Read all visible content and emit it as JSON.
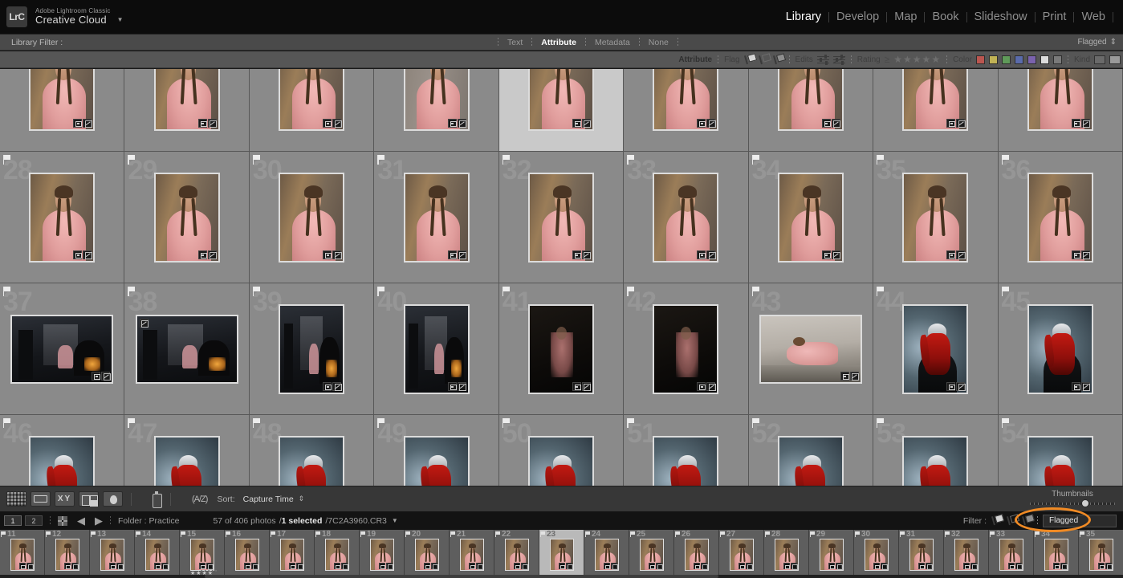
{
  "app": {
    "logo_text": "LrC",
    "product_line1": "Adobe Lightroom Classic",
    "product_line2": "Creative Cloud",
    "identity_caret": "▼"
  },
  "modules": [
    {
      "label": "Library",
      "active": true
    },
    {
      "label": "Develop",
      "active": false
    },
    {
      "label": "Map",
      "active": false
    },
    {
      "label": "Book",
      "active": false
    },
    {
      "label": "Slideshow",
      "active": false
    },
    {
      "label": "Print",
      "active": false
    },
    {
      "label": "Web",
      "active": false
    }
  ],
  "library_filter": {
    "label": "Library Filter :",
    "tabs": [
      {
        "label": "Text",
        "active": false
      },
      {
        "label": "Attribute",
        "active": true
      },
      {
        "label": "Metadata",
        "active": false
      },
      {
        "label": "None",
        "active": false
      }
    ],
    "saved_preset": "Flagged",
    "saved_preset_caret": "⇕"
  },
  "attribute_bar": {
    "attribute_label": "Attribute",
    "flag_label": "Flag",
    "flag_icons": [
      "flag-picked-icon",
      "flag-unflagged-icon",
      "flag-rejected-icon"
    ],
    "edits_label": "Edits",
    "edit_icons": [
      "edited-icon",
      "unedited-icon"
    ],
    "rating_label": "Rating",
    "rating_operator": "≥",
    "stars": "★★★★★",
    "star_count": 5,
    "rating_value": 0,
    "color_label": "Color",
    "color_swatches": [
      "#b9544f",
      "#c0b councils"
    ],
    "colors": [
      "#bb5650",
      "#c0b255",
      "#5f9a59",
      "#5a6bab",
      "#7a62ad",
      "#dcdcdc",
      "#7a7a7a"
    ],
    "kind_label": "Kind",
    "kind_icons": [
      "photo-kind-icon",
      "video-kind-icon"
    ]
  },
  "grid": {
    "rows": [
      {
        "clipped_top": true,
        "cells": [
          {
            "num": "",
            "flag": true,
            "selected": false,
            "orient": "portrait",
            "badges": [
              "crop",
              "edit"
            ],
            "art": "pink-studio"
          },
          {
            "num": "",
            "flag": true,
            "selected": false,
            "orient": "portrait",
            "badges": [
              "crop",
              "edit"
            ],
            "art": "pink-studio"
          },
          {
            "num": "",
            "flag": true,
            "selected": false,
            "orient": "portrait",
            "badges": [
              "crop",
              "edit"
            ],
            "art": "pink-studio"
          },
          {
            "num": "",
            "flag": true,
            "selected": false,
            "orient": "portrait",
            "badges": [
              "crop",
              "edit"
            ],
            "art": "pink-gray"
          },
          {
            "num": "",
            "flag": true,
            "selected": true,
            "orient": "portrait",
            "badges": [
              "crop",
              "edit"
            ],
            "art": "pink-studio"
          },
          {
            "num": "",
            "flag": true,
            "selected": false,
            "orient": "portrait",
            "badges": [
              "crop",
              "edit"
            ],
            "art": "pink-studio"
          },
          {
            "num": "",
            "flag": true,
            "selected": false,
            "orient": "portrait",
            "badges": [
              "crop",
              "edit"
            ],
            "art": "pink-studio"
          },
          {
            "num": "",
            "flag": true,
            "selected": false,
            "orient": "portrait",
            "badges": [
              "crop",
              "edit"
            ],
            "art": "pink-studio"
          },
          {
            "num": "",
            "flag": true,
            "selected": false,
            "orient": "portrait",
            "badges": [
              "crop",
              "edit"
            ],
            "art": "pink-studio"
          }
        ]
      },
      {
        "clipped_top": false,
        "cells": [
          {
            "num": "28",
            "flag": true,
            "selected": false,
            "orient": "portrait",
            "badges": [
              "crop",
              "edit"
            ],
            "art": "pink-studio"
          },
          {
            "num": "29",
            "flag": true,
            "selected": false,
            "orient": "portrait",
            "badges": [
              "crop",
              "edit"
            ],
            "art": "pink-studio"
          },
          {
            "num": "30",
            "flag": true,
            "selected": false,
            "orient": "portrait",
            "badges": [
              "crop",
              "edit"
            ],
            "art": "pink-studio"
          },
          {
            "num": "31",
            "flag": true,
            "selected": false,
            "orient": "portrait",
            "badges": [
              "crop",
              "edit"
            ],
            "art": "pink-studio"
          },
          {
            "num": "32",
            "flag": true,
            "selected": false,
            "orient": "portrait",
            "badges": [
              "crop",
              "edit"
            ],
            "art": "pink-studio"
          },
          {
            "num": "33",
            "flag": true,
            "selected": false,
            "orient": "portrait",
            "badges": [
              "crop",
              "edit"
            ],
            "art": "pink-studio"
          },
          {
            "num": "34",
            "flag": true,
            "selected": false,
            "orient": "portrait",
            "badges": [
              "crop",
              "edit"
            ],
            "art": "pink-studio"
          },
          {
            "num": "35",
            "flag": true,
            "selected": false,
            "orient": "portrait",
            "badges": [
              "crop",
              "edit"
            ],
            "art": "pink-studio"
          },
          {
            "num": "36",
            "flag": true,
            "selected": false,
            "orient": "portrait",
            "badges": [
              "crop",
              "edit"
            ],
            "art": "pink-studio"
          }
        ]
      },
      {
        "clipped_top": false,
        "cells": [
          {
            "num": "37",
            "flag": true,
            "selected": false,
            "orient": "landscape",
            "badges": [
              "crop",
              "edit"
            ],
            "art": "dark-venue"
          },
          {
            "num": "38",
            "flag": true,
            "selected": false,
            "orient": "landscape",
            "badges": [
              "edit-tl"
            ],
            "art": "dark-venue"
          },
          {
            "num": "39",
            "flag": true,
            "selected": false,
            "orient": "portrait",
            "badges": [
              "crop",
              "edit"
            ],
            "art": "dark-venue"
          },
          {
            "num": "40",
            "flag": true,
            "selected": false,
            "orient": "portrait",
            "badges": [
              "crop",
              "edit"
            ],
            "art": "dark-venue"
          },
          {
            "num": "41",
            "flag": true,
            "selected": false,
            "orient": "portrait",
            "badges": [
              "crop",
              "edit"
            ],
            "art": "dark-room"
          },
          {
            "num": "42",
            "flag": true,
            "selected": false,
            "orient": "portrait",
            "badges": [
              "crop",
              "edit"
            ],
            "art": "dark-room"
          },
          {
            "num": "43",
            "flag": true,
            "selected": false,
            "orient": "landscape",
            "badges": [
              "crop",
              "edit"
            ],
            "art": "bed-scene"
          },
          {
            "num": "44",
            "flag": true,
            "selected": false,
            "orient": "portrait",
            "badges": [
              "crop",
              "edit"
            ],
            "art": "red-hair"
          },
          {
            "num": "45",
            "flag": true,
            "selected": false,
            "orient": "portrait",
            "badges": [
              "crop",
              "edit"
            ],
            "art": "red-hair"
          }
        ]
      },
      {
        "clipped_top": false,
        "cells": [
          {
            "num": "46",
            "flag": true,
            "selected": false,
            "orient": "portrait",
            "badges": [],
            "art": "red-hair"
          },
          {
            "num": "47",
            "flag": true,
            "selected": false,
            "orient": "portrait",
            "badges": [],
            "art": "red-hair"
          },
          {
            "num": "48",
            "flag": true,
            "selected": false,
            "orient": "portrait",
            "badges": [],
            "art": "red-hair"
          },
          {
            "num": "49",
            "flag": true,
            "selected": false,
            "orient": "portrait",
            "badges": [],
            "art": "red-hair"
          },
          {
            "num": "50",
            "flag": true,
            "selected": false,
            "orient": "portrait",
            "badges": [],
            "art": "red-hair"
          },
          {
            "num": "51",
            "flag": true,
            "selected": false,
            "orient": "portrait",
            "badges": [],
            "art": "red-hair"
          },
          {
            "num": "52",
            "flag": true,
            "selected": false,
            "orient": "portrait",
            "badges": [],
            "art": "red-hair"
          },
          {
            "num": "53",
            "flag": true,
            "selected": false,
            "orient": "portrait",
            "badges": [],
            "art": "red-hair"
          },
          {
            "num": "54",
            "flag": true,
            "selected": false,
            "orient": "portrait",
            "badges": [],
            "art": "red-hair"
          }
        ]
      }
    ]
  },
  "toolbar": {
    "view_icons": [
      "grid-view-icon",
      "loupe-view-icon",
      "compare-view-icon",
      "survey-view-icon",
      "people-view-icon"
    ],
    "compare_label": "XY",
    "painter_icon": "spray-can-icon",
    "sort_direction_icon": "sort-az-icon",
    "sort_label": "Sort:",
    "sort_value": "Capture Time",
    "sort_caret": "⇕",
    "thumbnails_label": "Thumbnails",
    "thumbnail_size_pct": 60
  },
  "statusbar": {
    "page_buttons": [
      "1",
      "2"
    ],
    "grid_icon": "grid-icon",
    "prev_icon": "◀",
    "next_icon": "▶",
    "source_label": "Folder : Practice",
    "photo_count": "57 of 406 photos",
    "separator1": "/",
    "selected_text": "1 selected",
    "separator2": "/",
    "filename": "7C2A3960.CR3",
    "filename_caret": "▼",
    "filter_label": "Filter :",
    "filter_flag_icons": [
      "flag-picked-icon",
      "flag-unflagged-icon",
      "flag-rejected-icon"
    ],
    "filter_preset": "Flagged",
    "annotation": "orange-ellipse-highlight"
  },
  "filmstrip": {
    "cells": [
      {
        "num": "11",
        "art": "pink-studio",
        "selected": false,
        "badges": true,
        "stars": ""
      },
      {
        "num": "12",
        "art": "pink-studio",
        "selected": false,
        "badges": true,
        "stars": ""
      },
      {
        "num": "13",
        "art": "pink-studio",
        "selected": false,
        "badges": true,
        "stars": ""
      },
      {
        "num": "14",
        "art": "pink-studio",
        "selected": false,
        "badges": true,
        "stars": ""
      },
      {
        "num": "15",
        "art": "pink-studio",
        "selected": false,
        "badges": true,
        "stars": "★★★★"
      },
      {
        "num": "16",
        "art": "pink-studio",
        "selected": false,
        "badges": true,
        "stars": ""
      },
      {
        "num": "17",
        "art": "pink-studio",
        "selected": false,
        "badges": true,
        "stars": ""
      },
      {
        "num": "18",
        "art": "pink-studio",
        "selected": false,
        "badges": true,
        "stars": ""
      },
      {
        "num": "19",
        "art": "pink-studio",
        "selected": false,
        "badges": true,
        "stars": ""
      },
      {
        "num": "20",
        "art": "pink-studio",
        "selected": false,
        "badges": true,
        "stars": ""
      },
      {
        "num": "21",
        "art": "pink-studio",
        "selected": false,
        "badges": true,
        "stars": ""
      },
      {
        "num": "22",
        "art": "pink-studio",
        "selected": false,
        "badges": true,
        "stars": ""
      },
      {
        "num": "23",
        "art": "pink-studio",
        "selected": true,
        "badges": true,
        "stars": ""
      },
      {
        "num": "24",
        "art": "pink-studio",
        "selected": false,
        "badges": true,
        "stars": ""
      },
      {
        "num": "25",
        "art": "pink-studio",
        "selected": false,
        "badges": true,
        "stars": ""
      },
      {
        "num": "26",
        "art": "pink-studio",
        "selected": false,
        "badges": true,
        "stars": ""
      },
      {
        "num": "27",
        "art": "pink-studio",
        "selected": false,
        "badges": true,
        "stars": ""
      },
      {
        "num": "28",
        "art": "pink-studio",
        "selected": false,
        "badges": true,
        "stars": ""
      },
      {
        "num": "29",
        "art": "pink-studio",
        "selected": false,
        "badges": true,
        "stars": ""
      },
      {
        "num": "30",
        "art": "pink-studio",
        "selected": false,
        "badges": true,
        "stars": ""
      },
      {
        "num": "31",
        "art": "pink-studio",
        "selected": false,
        "badges": true,
        "stars": ""
      },
      {
        "num": "32",
        "art": "pink-studio",
        "selected": false,
        "badges": true,
        "stars": ""
      },
      {
        "num": "33",
        "art": "pink-studio",
        "selected": false,
        "badges": true,
        "stars": ""
      },
      {
        "num": "34",
        "art": "pink-studio",
        "selected": false,
        "badges": true,
        "stars": ""
      },
      {
        "num": "35",
        "art": "pink-studio",
        "selected": false,
        "badges": true,
        "stars": ""
      }
    ]
  },
  "colors": {
    "accent_orange": "#f08a24",
    "grid_cell_bg": "#8a8a8a",
    "grid_cell_selected_bg": "#c9c9c9",
    "panel_bg": "#373737",
    "filter_bar_bg": "#4a4a4a",
    "attribute_bar_bg": "#565656",
    "filmstrip_bg": "#2f2f2f",
    "status_bar_bg": "#131313",
    "top_bar_bg": "#0c0c0c"
  }
}
